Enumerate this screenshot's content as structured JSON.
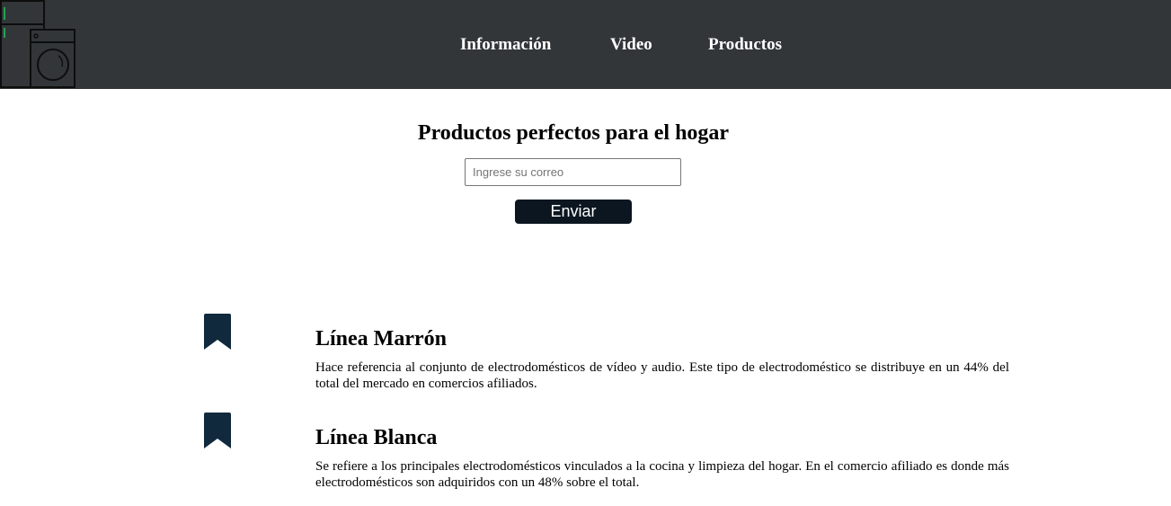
{
  "nav": {
    "items": [
      {
        "label": "Información"
      },
      {
        "label": "Video"
      },
      {
        "label": "Productos"
      }
    ]
  },
  "hero": {
    "title": "Productos perfectos para el hogar",
    "email_placeholder": "Ingrese su correo",
    "email_value": "",
    "submit_label": "Enviar"
  },
  "features": [
    {
      "icon": "bookmark-icon",
      "title": "Línea Marrón",
      "text": "Hace referencia al conjunto de electrodomésticos de vídeo y audio. Este tipo de electrodoméstico se distribuye en un 44% del total del mercado en comercios afiliados."
    },
    {
      "icon": "bookmark-icon",
      "title": "Línea Blanca",
      "text": "Se refiere a los principales electrodomésticos vinculados a la cocina y limpieza del hogar. En el comercio afiliado es donde más electrodomésticos son adquiridos con un 48% sobre el total."
    }
  ],
  "colors": {
    "header_bg": "#323639",
    "button_bg": "#0b1620",
    "icon_color": "#10293d",
    "logo_accent": "#22c55e"
  }
}
